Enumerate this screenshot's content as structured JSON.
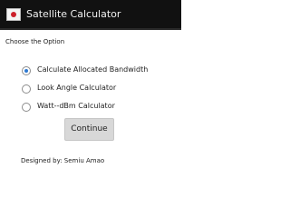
{
  "app": {
    "title": "Satellite Calculator",
    "icon": "satellite-flag-icon"
  },
  "form": {
    "prompt": "Choose the Option",
    "options": [
      {
        "label": "Calculate Allocated Bandwidth",
        "selected": true
      },
      {
        "label": "Look Angle Calculator",
        "selected": false
      },
      {
        "label": "Watt--dBm Calculator",
        "selected": false
      }
    ],
    "continue_label": "Continue"
  },
  "footer": {
    "designer": "Designed by: Semiu Amao"
  },
  "colors": {
    "action_bar": "#111111",
    "radio_accent": "#2f7ad1",
    "button_background": "#d8d8d8"
  }
}
